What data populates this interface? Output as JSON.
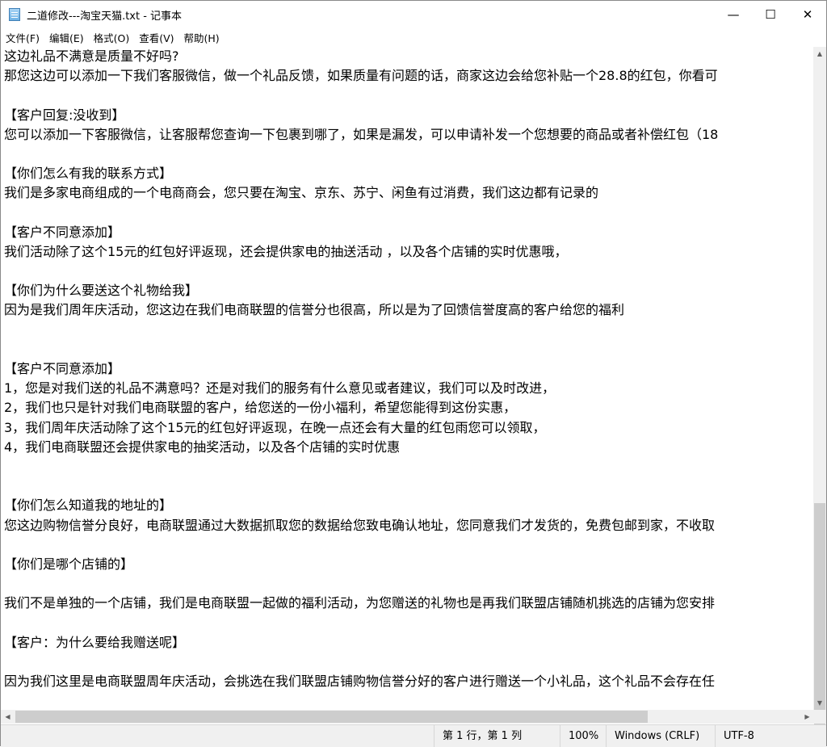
{
  "window": {
    "title": "二道修改---淘宝天猫.txt - 记事本",
    "minimize_glyph": "—",
    "maximize_glyph": "☐",
    "close_glyph": "✕"
  },
  "menu": [
    "文件(F)",
    "编辑(E)",
    "格式(O)",
    "查看(V)",
    "帮助(H)"
  ],
  "lines": [
    "这边礼品不满意是质量不好吗?",
    "那您这边可以添加一下我们客服微信，做一个礼品反馈，如果质量有问题的话，商家这边会给您补贴一个28.8的红包，你看可",
    "",
    "【客户回复:没收到】",
    "您可以添加一下客服微信，让客服帮您查询一下包裹到哪了，如果是漏发，可以申请补发一个您想要的商品或者补偿红包（18",
    "",
    "【你们怎么有我的联系方式】",
    "我们是多家电商组成的一个电商商会，您只要在淘宝、京东、苏宁、闲鱼有过消费，我们这边都有记录的",
    "",
    "【客户不同意添加】",
    "我们活动除了这个15元的红包好评返现，还会提供家电的抽送活动 ，以及各个店铺的实时优惠哦，",
    "",
    "【你们为什么要送这个礼物给我】",
    "因为是我们周年庆活动，您这边在我们电商联盟的信誉分也很高，所以是为了回馈信誉度高的客户给您的福利",
    "",
    "",
    "【客户不同意添加】",
    "1，您是对我们送的礼品不满意吗？还是对我们的服务有什么意见或者建议，我们可以及时改进，",
    "2，我们也只是针对我们电商联盟的客户，给您送的一份小福利，希望您能得到这份实惠，",
    "3，我们周年庆活动除了这个15元的红包好评返现，在晚一点还会有大量的红包雨您可以领取，",
    "4，我们电商联盟还会提供家电的抽奖活动，以及各个店铺的实时优惠",
    "",
    "",
    "【你们怎么知道我的地址的】",
    "您这边购物信誉分良好，电商联盟通过大数据抓取您的数据给您致电确认地址，您同意我们才发货的，免费包邮到家，不收取",
    "",
    "【你们是哪个店铺的】",
    "",
    "我们不是单独的一个店铺，我们是电商联盟一起做的福利活动，为您赠送的礼物也是再我们联盟店铺随机挑选的店铺为您安排",
    "",
    "【客户：为什么要给我赠送呢】",
    "",
    "因为我们这里是电商联盟周年庆活动，会挑选在我们联盟店铺购物信誉分好的客户进行赠送一个小礼品，这个礼品不会存在任"
  ],
  "status": {
    "position": "第 1 行，第 1 列",
    "zoom": "100%",
    "line_ending": "Windows (CRLF)",
    "encoding": "UTF-8"
  },
  "scroll": {
    "up_glyph": "▲",
    "down_glyph": "▼",
    "left_glyph": "◀",
    "right_glyph": "▶"
  }
}
